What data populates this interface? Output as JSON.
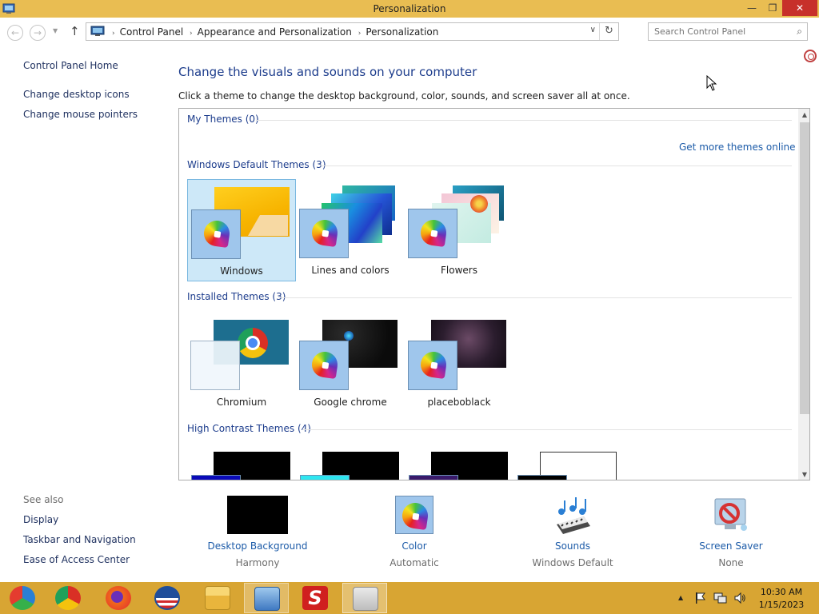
{
  "window": {
    "title": "Personalization",
    "min_glyph": "—",
    "max_glyph": "❐",
    "close_glyph": "✕"
  },
  "nav": {
    "back_glyph": "←",
    "forward_glyph": "→",
    "dropdown_glyph": "▼",
    "up_glyph": "↑",
    "breadcrumb": [
      "Control Panel",
      "Appearance and Personalization",
      "Personalization"
    ],
    "breadcrumb_sep": "›",
    "address_dropdown_glyph": "∨",
    "refresh_glyph": "↻",
    "search_placeholder": "Search Control Panel",
    "search_glyph": "⌕"
  },
  "left": {
    "home": "Control Panel Home",
    "links": [
      "Change desktop icons",
      "Change mouse pointers"
    ],
    "see_also_title": "See also",
    "see_also": [
      "Display",
      "Taskbar and Navigation",
      "Ease of Access Center"
    ]
  },
  "main": {
    "heading": "Change the visuals and sounds on your computer",
    "subtext": "Click a theme to change the desktop background, color, sounds, and screen saver all at once.",
    "more_themes_link": "Get more themes online",
    "groups": [
      {
        "title": "My Themes (0)",
        "themes": []
      },
      {
        "title": "Windows Default Themes (3)",
        "themes": [
          "Windows",
          "Lines and colors",
          "Flowers"
        ],
        "selected": "Windows"
      },
      {
        "title": "Installed Themes (3)",
        "themes": [
          "Chromium",
          "Google chrome",
          "placeboblack"
        ]
      },
      {
        "title": "High Contrast Themes (4)",
        "themes": []
      }
    ]
  },
  "bottom": [
    {
      "label": "Desktop Background",
      "value": "Harmony",
      "icon": "desktop-background-icon"
    },
    {
      "label": "Color",
      "value": "Automatic",
      "icon": "color-fan-icon"
    },
    {
      "label": "Sounds",
      "value": "Windows Default",
      "icon": "sounds-icon"
    },
    {
      "label": "Screen Saver",
      "value": "None",
      "icon": "screen-saver-icon"
    }
  ],
  "taskbar": {
    "apps": [
      "chromium-icon",
      "chrome-icon",
      "firefox-icon",
      "obama-logo-icon",
      "file-explorer-icon",
      "network-icon",
      "s-app-icon",
      "control-panel-icon"
    ],
    "tray_up_glyph": "▲",
    "time": "10:30 AM",
    "date": "1/15/2023"
  },
  "colors": {
    "titlebar": "#e9bd52",
    "taskbar": "#d8a533",
    "heading": "#1c3c8c",
    "link": "#1c5ba8"
  }
}
